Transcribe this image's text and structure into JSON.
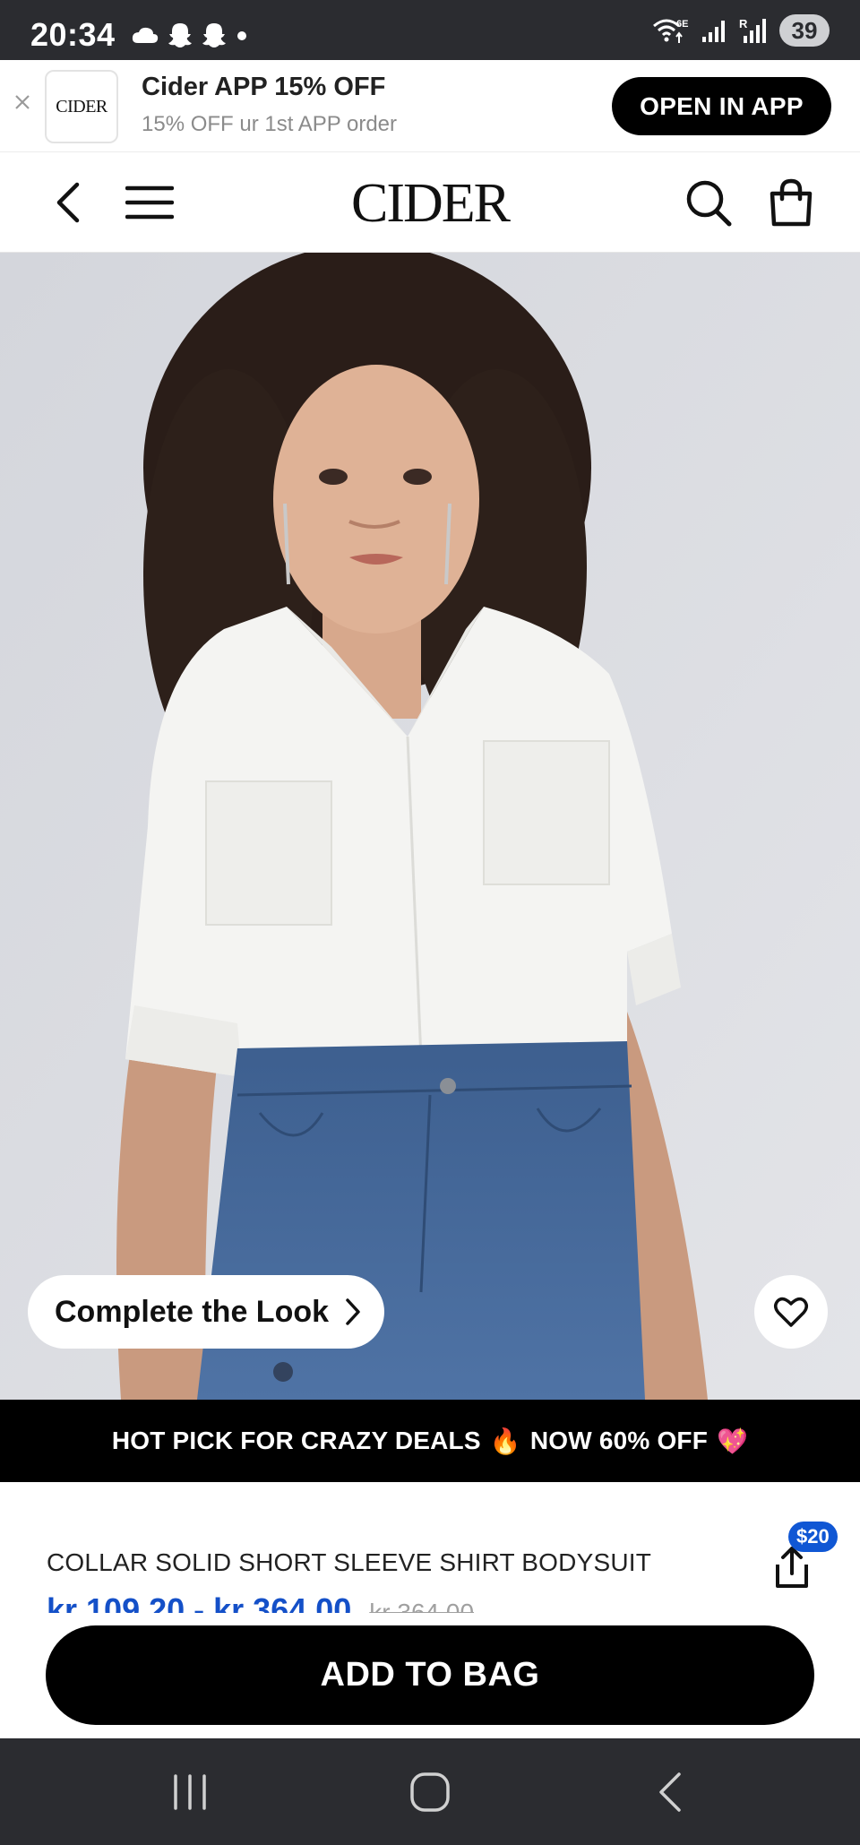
{
  "status_bar": {
    "time": "20:34",
    "battery": "39",
    "notification_icons": [
      "cloud-icon",
      "snapchat-icon",
      "snapchat-icon",
      "dot-icon"
    ],
    "system_icons": [
      "wifi-6e-icon",
      "signal-icon",
      "roaming-signal-icon",
      "battery-icon"
    ]
  },
  "app_banner": {
    "logo_text": "CIDER",
    "title": "Cider APP 15% OFF",
    "subtitle": "15% OFF ur 1st APP order",
    "open_button": "OPEN IN APP"
  },
  "header": {
    "logo": "CIDER",
    "icons": [
      "back-chevron-icon",
      "hamburger-menu-icon",
      "search-icon",
      "shopping-bag-icon"
    ]
  },
  "product_image": {
    "complete_look_label": "Complete the Look",
    "icons": [
      "chevron-right-icon",
      "heart-icon"
    ]
  },
  "promo": {
    "text_before": "HOT PICK FOR CRAZY DEALS",
    "emoji_fire": "🔥",
    "text_after": "NOW 60% OFF",
    "emoji_heart": "💖"
  },
  "product": {
    "title": "COLLAR SOLID SHORT SLEEVE SHIRT BODYSUIT",
    "price_range": "kr 109.20 - kr 364.00",
    "original_price": "kr 364.00",
    "share_badge": "$20"
  },
  "actions": {
    "add_to_bag": "ADD TO BAG"
  },
  "system_nav": {
    "icons": [
      "recent-apps-icon",
      "home-icon",
      "back-icon"
    ]
  },
  "colors": {
    "status_bar_bg": "#2b2c30",
    "accent_blue": "#1450c8",
    "badge_blue": "#1057d4",
    "black": "#000000"
  }
}
